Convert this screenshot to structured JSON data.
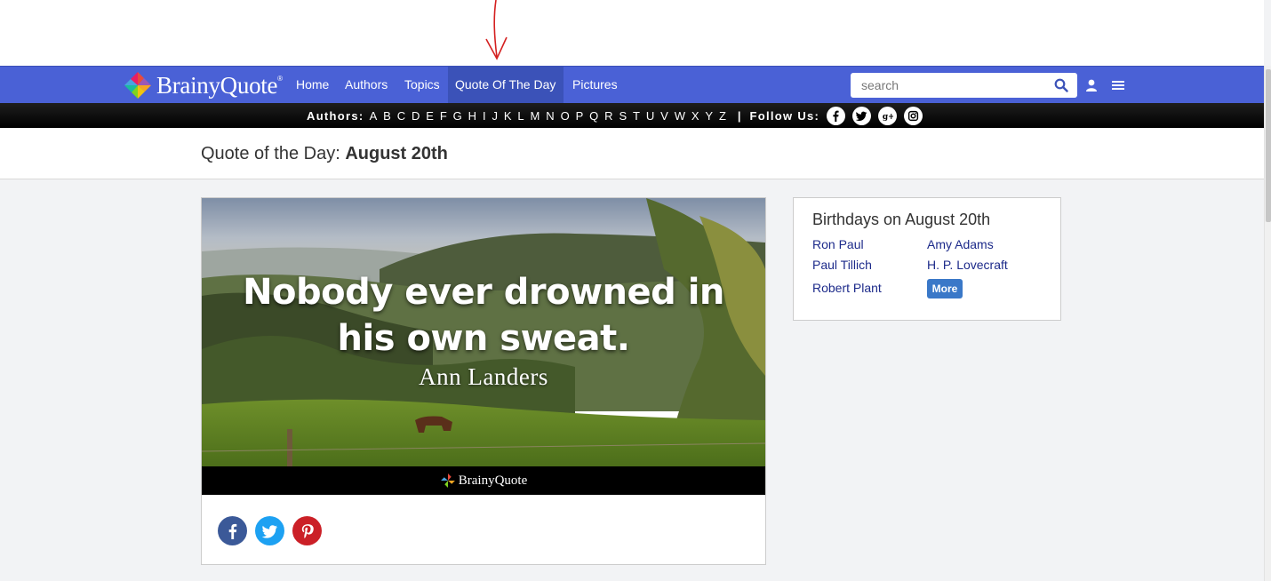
{
  "brand": {
    "name": "BrainyQuote",
    "reg_mark": "®"
  },
  "nav": {
    "items": [
      {
        "label": "Home"
      },
      {
        "label": "Authors"
      },
      {
        "label": "Topics"
      },
      {
        "label": "Quote Of The Day",
        "active": true
      },
      {
        "label": "Pictures"
      }
    ],
    "search_placeholder": "search"
  },
  "authors_bar": {
    "label": "Authors:",
    "letters": [
      "A",
      "B",
      "C",
      "D",
      "E",
      "F",
      "G",
      "H",
      "I",
      "J",
      "K",
      "L",
      "M",
      "N",
      "O",
      "P",
      "Q",
      "R",
      "S",
      "T",
      "U",
      "V",
      "W",
      "X",
      "Y",
      "Z"
    ],
    "separator": "|",
    "follow_label": "Follow Us:",
    "social": [
      "facebook-icon",
      "twitter-icon",
      "google-plus-icon",
      "instagram-icon"
    ]
  },
  "page": {
    "title_prefix": "Quote of the Day:",
    "title_date": "August 20th"
  },
  "quote": {
    "line1": "Nobody ever drowned in",
    "line2": "his own sweat.",
    "author": "Ann Landers",
    "footer_logo": "BrainyQuote",
    "share": [
      {
        "name": "facebook",
        "color": "#3b5998"
      },
      {
        "name": "twitter",
        "color": "#1da1f2"
      },
      {
        "name": "pinterest",
        "color": "#cb2027"
      }
    ]
  },
  "birthdays": {
    "title": "Birthdays on August 20th",
    "people": [
      "Ron Paul",
      "Amy Adams",
      "Paul Tillich",
      "H. P. Lovecraft",
      "Robert Plant"
    ],
    "more_label": "More"
  },
  "colors": {
    "nav_bg": "#4a61d6",
    "nav_active": "#3b52b8",
    "link": "#1c2a8a",
    "more_button": "#3a78c8",
    "annotation_arrow": "#d42020"
  }
}
